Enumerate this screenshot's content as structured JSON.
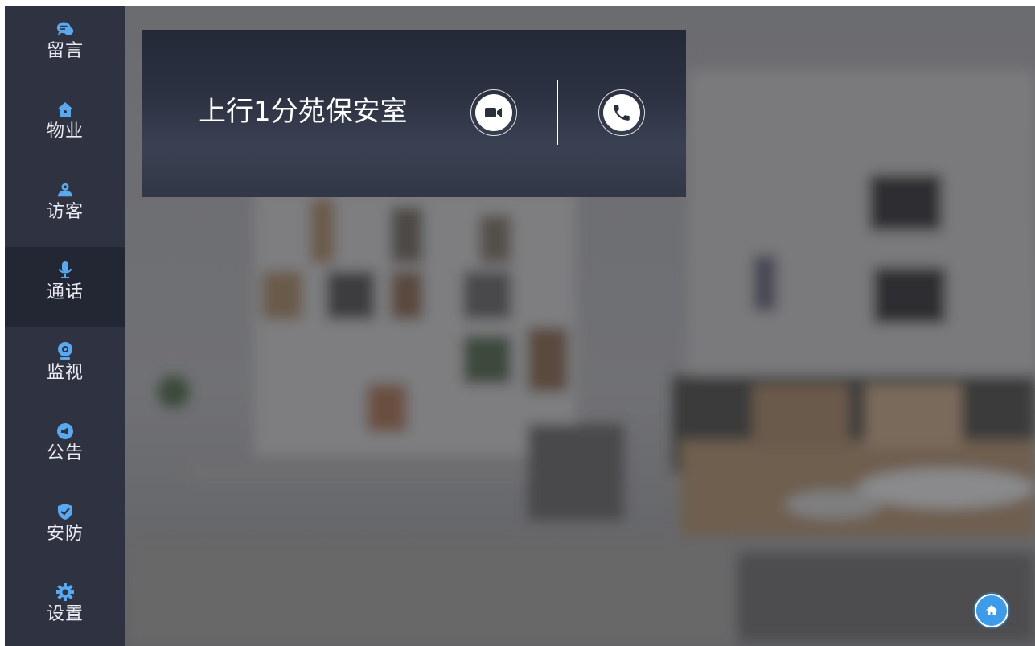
{
  "sidebar": {
    "items": [
      {
        "label": "留言",
        "icon": "message-icon"
      },
      {
        "label": "物业",
        "icon": "property-home-icon"
      },
      {
        "label": "访客",
        "icon": "visitor-icon"
      },
      {
        "label": "通话",
        "icon": "microphone-icon",
        "active": true
      },
      {
        "label": "监视",
        "icon": "camera-icon"
      },
      {
        "label": "公告",
        "icon": "megaphone-icon"
      },
      {
        "label": "安防",
        "icon": "shield-icon"
      },
      {
        "label": "设置",
        "icon": "gear-icon"
      }
    ]
  },
  "call": {
    "title": "上行1分苑保安室",
    "video_button": "video-call-icon",
    "voice_button": "phone-icon"
  },
  "home_button": "home-icon",
  "colors": {
    "sidebar_bg": "#2f3240",
    "sidebar_active": "#232633",
    "icon_accent": "#5aa9ee",
    "home_button": "#3d9be9"
  }
}
